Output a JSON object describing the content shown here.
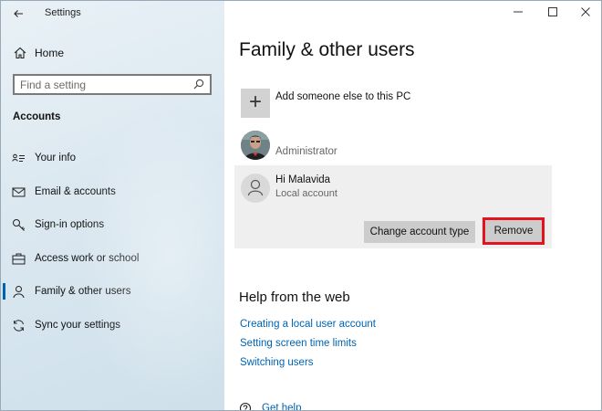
{
  "window": {
    "title": "Settings"
  },
  "nav": {
    "home_label": "Home",
    "search_placeholder": "Find a setting",
    "section_title": "Accounts",
    "items": [
      {
        "label": "Your info",
        "icon": "contact-card-icon"
      },
      {
        "label": "Email & accounts",
        "icon": "mail-icon"
      },
      {
        "label": "Sign-in options",
        "icon": "key-icon"
      },
      {
        "label": "Access work or school",
        "icon": "briefcase-icon"
      },
      {
        "label": "Family & other users",
        "icon": "person-icon",
        "selected": true
      },
      {
        "label": "Sync your settings",
        "icon": "sync-icon"
      }
    ]
  },
  "main": {
    "title": "Family & other users",
    "add_user_label": "Add someone else to this PC",
    "admin_label": "Administrator",
    "selected_account": {
      "name": "Hi Malavida",
      "type": "Local account",
      "change_button": "Change account type",
      "remove_button": "Remove"
    },
    "help": {
      "title": "Help from the web",
      "links": [
        "Creating a local user account",
        "Setting screen time limits",
        "Switching users"
      ],
      "get_help": "Get help"
    }
  },
  "colors": {
    "accent": "#0063b1",
    "highlight_border": "#e3141f",
    "nav_background": "#dbe8f0"
  }
}
